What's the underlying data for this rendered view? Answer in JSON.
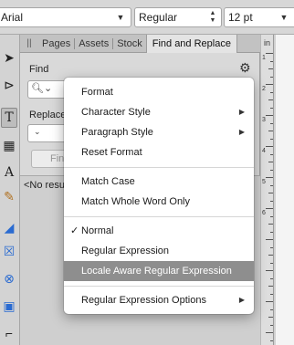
{
  "toolbar": {
    "font_name": "Arial",
    "font_style": "Regular",
    "font_size": "12 pt"
  },
  "tabs": [
    {
      "label": "Pages"
    },
    {
      "label": "Assets"
    },
    {
      "label": "Stock"
    },
    {
      "label": "Find and Replace"
    }
  ],
  "find_replace": {
    "find_label": "Find",
    "replace_label": "Replace",
    "find_button": "Find",
    "results_text": "<No results>",
    "find_value": ""
  },
  "ruler": {
    "unit": "in",
    "marks": [
      "1",
      "2",
      "3",
      "4",
      "5",
      "6"
    ]
  },
  "menu": {
    "items": [
      {
        "label": "Format",
        "submenu": false
      },
      {
        "label": "Character Style",
        "submenu": true
      },
      {
        "label": "Paragraph Style",
        "submenu": true
      },
      {
        "label": "Reset Format",
        "submenu": false
      },
      {
        "label": "Match Case",
        "submenu": false
      },
      {
        "label": "Match Whole Word Only",
        "submenu": false
      },
      {
        "label": "Normal",
        "checked": true
      },
      {
        "label": "Regular Expression",
        "checked": false
      },
      {
        "label": "Locale Aware Regular Expression",
        "highlighted": true
      },
      {
        "label": "Regular Expression Options",
        "submenu": true
      }
    ]
  },
  "colors": {
    "menu_highlight": "#8e8e8e",
    "panel_bg": "#d9d9d9",
    "toolbar_bg": "#d7d7d7"
  },
  "icons": [
    "move-arrow-icon",
    "node-tool-icon",
    "frame-text-icon",
    "table-icon",
    "artistic-text-icon",
    "paintbrush-icon",
    "fill-bucket-icon",
    "rect-frame-icon",
    "ellipse-frame-icon",
    "picture-frame-icon",
    "gear-icon",
    "search-icon",
    "chevron-down-icon",
    "chevron-right-icon",
    "checkmark-icon"
  ]
}
